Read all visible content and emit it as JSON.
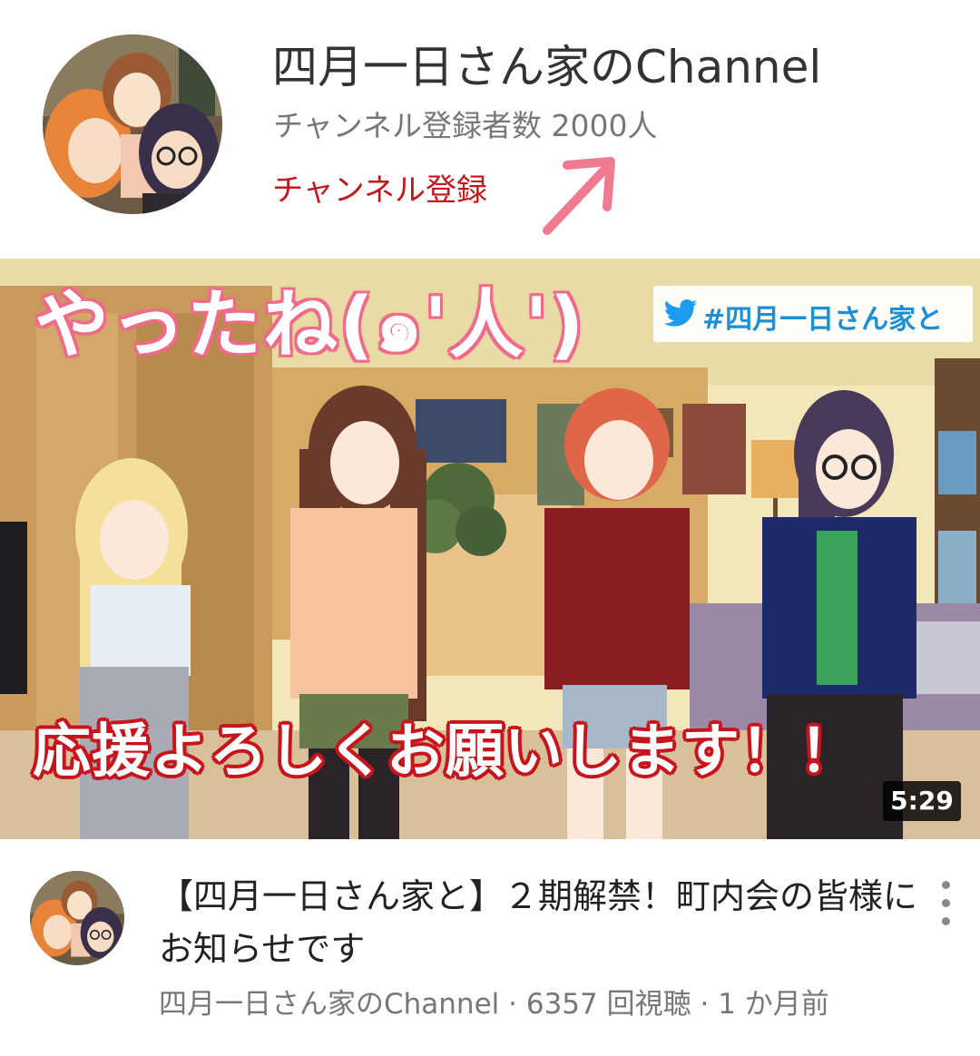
{
  "channel": {
    "name": "四月一日さん家のChannel",
    "subscribers": "チャンネル登録者数 2000人",
    "subscribe_label": "チャンネル登録",
    "avatar_icon": "channel-avatar-icon",
    "annotation_color": "#f07a90"
  },
  "thumbnail": {
    "top_text": "やったね(๑'人')",
    "hashtag": "#四月一日さん家と",
    "bottom_text": "応援よろしくお願いします！！",
    "duration": "5:29",
    "accent_pink": "#f06a8a",
    "accent_red": "#c8141c",
    "twitter_blue": "#1d9bf0"
  },
  "video": {
    "title": "【四月一日さん家と】２期解禁！町内会の皆様にお知らせです",
    "channel": "四月一日さん家のChannel",
    "views": "6357 回視聴",
    "age": "1 か月前",
    "separator": "·"
  }
}
